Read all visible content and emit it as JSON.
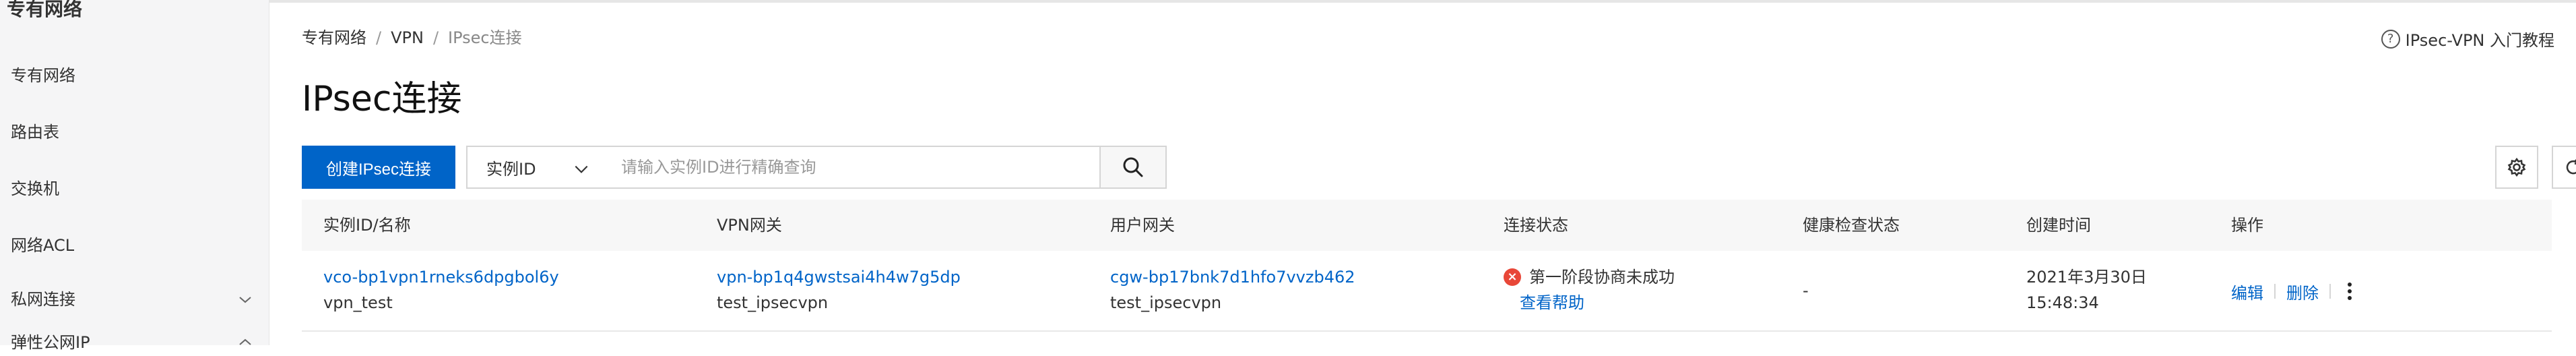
{
  "sidebar": {
    "title": "专有网络",
    "items": [
      {
        "label": "专有网络"
      },
      {
        "label": "路由表"
      },
      {
        "label": "交换机"
      },
      {
        "label": "网络ACL"
      },
      {
        "label": "私网连接",
        "chevron": "chevron-down-icon"
      },
      {
        "label": "弹性公网IP",
        "chevron": "chevron-up-icon"
      }
    ]
  },
  "breadcrumb": [
    "专有网络",
    "VPN",
    "IPsec连接"
  ],
  "page": {
    "title": "IPsec连接"
  },
  "help": {
    "label": "IPsec-VPN 入门教程",
    "icon": "question-circle-icon"
  },
  "toolbar": {
    "create_label": "创建IPsec连接",
    "filter_selected": "实例ID",
    "search_placeholder": "请输入实例ID进行精确查询",
    "search_icon": "search-icon",
    "settings_icon": "gear-icon",
    "refresh_icon": "refresh-icon"
  },
  "table": {
    "columns": [
      "实例ID/名称",
      "VPN网关",
      "用户网关",
      "连接状态",
      "健康检查状态",
      "创建时间",
      "操作"
    ],
    "rows": [
      {
        "instance_id": "vco-bp1vpn1rneks6dpgbol6y",
        "instance_name": "vpn_test",
        "vpn_gateway_id": "vpn-bp1q4gwstsai4h4w7g5dp",
        "vpn_gateway_name": "test_ipsecvpn",
        "user_gateway_id": "cgw-bp17bnk7d1hfo7vvzb462",
        "user_gateway_name": "test_ipsecvpn",
        "status": "第一阶段协商未成功",
        "status_help": "查看帮助",
        "status_color": "#e84738",
        "health": "-",
        "created_date": "2021年3月30日",
        "created_time": "15:48:34",
        "action_edit": "编辑",
        "action_delete": "删除"
      }
    ]
  },
  "colors": {
    "accent": "#0064c8",
    "error": "#e84738",
    "sidebar_bg": "#f5f5f6",
    "header_bg": "#f7f7f7"
  }
}
